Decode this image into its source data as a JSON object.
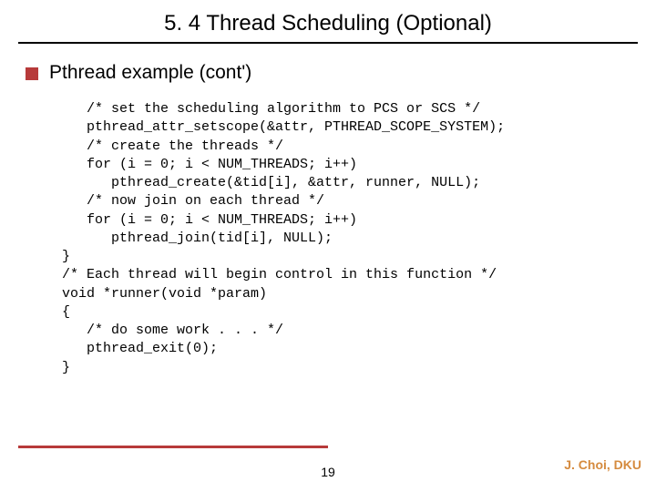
{
  "title": "5. 4 Thread Scheduling (Optional)",
  "bullet": "Pthread example (cont')",
  "code": "   /* set the scheduling algorithm to PCS or SCS */\n   pthread_attr_setscope(&attr, PTHREAD_SCOPE_SYSTEM);\n   /* create the threads */\n   for (i = 0; i < NUM_THREADS; i++)\n      pthread_create(&tid[i], &attr, runner, NULL);\n   /* now join on each thread */\n   for (i = 0; i < NUM_THREADS; i++)\n      pthread_join(tid[i], NULL);\n}\n/* Each thread will begin control in this function */\nvoid *runner(void *param)\n{\n   /* do some work . . . */\n   pthread_exit(0);\n}",
  "page_number": "19",
  "credit": "J. Choi, DKU"
}
